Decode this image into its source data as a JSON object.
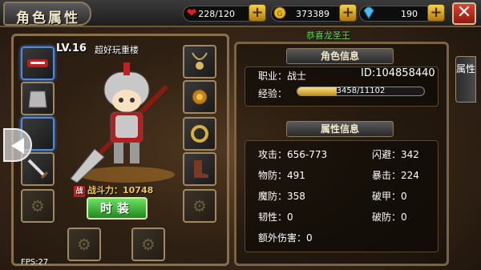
{
  "header": {
    "title": "角色属性",
    "hp": "228/120",
    "gold": "373389",
    "diamonds": "190",
    "close_label": "✕"
  },
  "congrats": "恭喜龙圣王",
  "character": {
    "level": "LV.16",
    "name": "超好玩重楼",
    "power_badge": "战",
    "power_label": "战斗力：10748",
    "fashion_button": "时装"
  },
  "side_tab": "属性",
  "role_info": {
    "title": "角色信息",
    "job_label": "职业：战士",
    "id_label": "ID:104858440",
    "exp_label": "经验：",
    "exp_text": "3458/11102",
    "exp_value": 3458,
    "exp_max": 11102
  },
  "attr_info": {
    "title": "属性信息",
    "attack": "攻击：656-773",
    "dodge": "闪避：342",
    "phys_def": "物防：491",
    "crit": "暴击：224",
    "magic_def": "魔防：358",
    "armor_break": "破甲：0",
    "toughness": "韧性：0",
    "defense_break": "破防：0",
    "extra_damage": "额外伤害：0"
  },
  "fps": "FPS:27",
  "colors": {
    "accent_gold": "#f3c84a",
    "green": "#5ee04a",
    "close_red": "#e04030"
  }
}
